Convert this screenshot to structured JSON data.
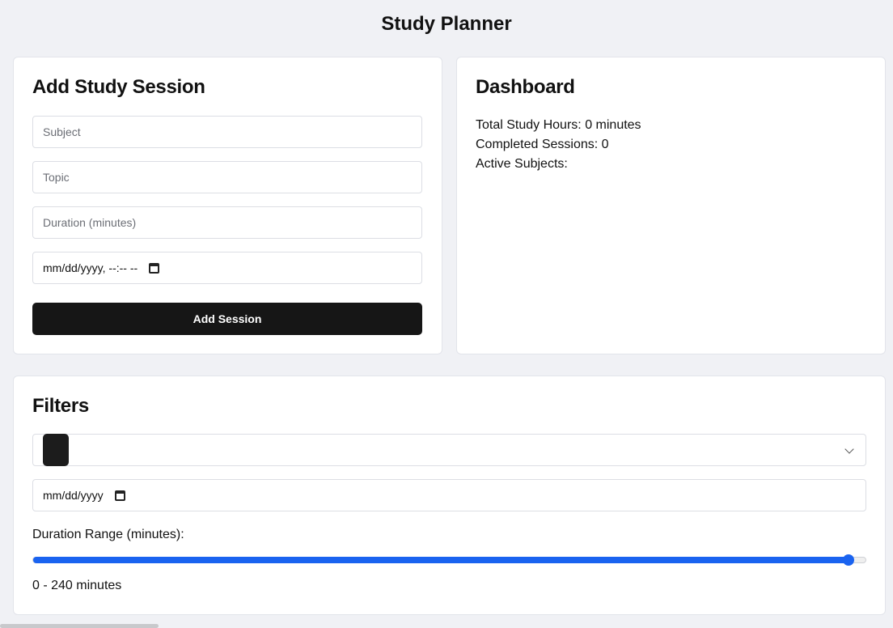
{
  "app": {
    "title": "Study Planner"
  },
  "add_session": {
    "title": "Add Study Session",
    "subject_placeholder": "Subject",
    "topic_placeholder": "Topic",
    "duration_placeholder": "Duration (minutes)",
    "datetime_placeholder": "mm/dd/yyyy, --:-- --",
    "submit_label": "Add Session"
  },
  "dashboard": {
    "title": "Dashboard",
    "total_hours_label": "Total Study Hours:",
    "total_hours_value": "0 minutes",
    "completed_label": "Completed Sessions:",
    "completed_value": "0",
    "active_subjects_label": "Active Subjects:",
    "active_subjects_value": ""
  },
  "filters": {
    "title": "Filters",
    "subject_select_value": "",
    "date_placeholder": "mm/dd/yyyy",
    "duration_range_label": "Duration Range (minutes):",
    "duration_min": 0,
    "duration_max": 240,
    "slider_value": 240,
    "range_text": "0 - 240 minutes",
    "accent_color": "#1a63f0"
  },
  "icons": [
    "calendar-icon",
    "chevron-down-icon"
  ]
}
